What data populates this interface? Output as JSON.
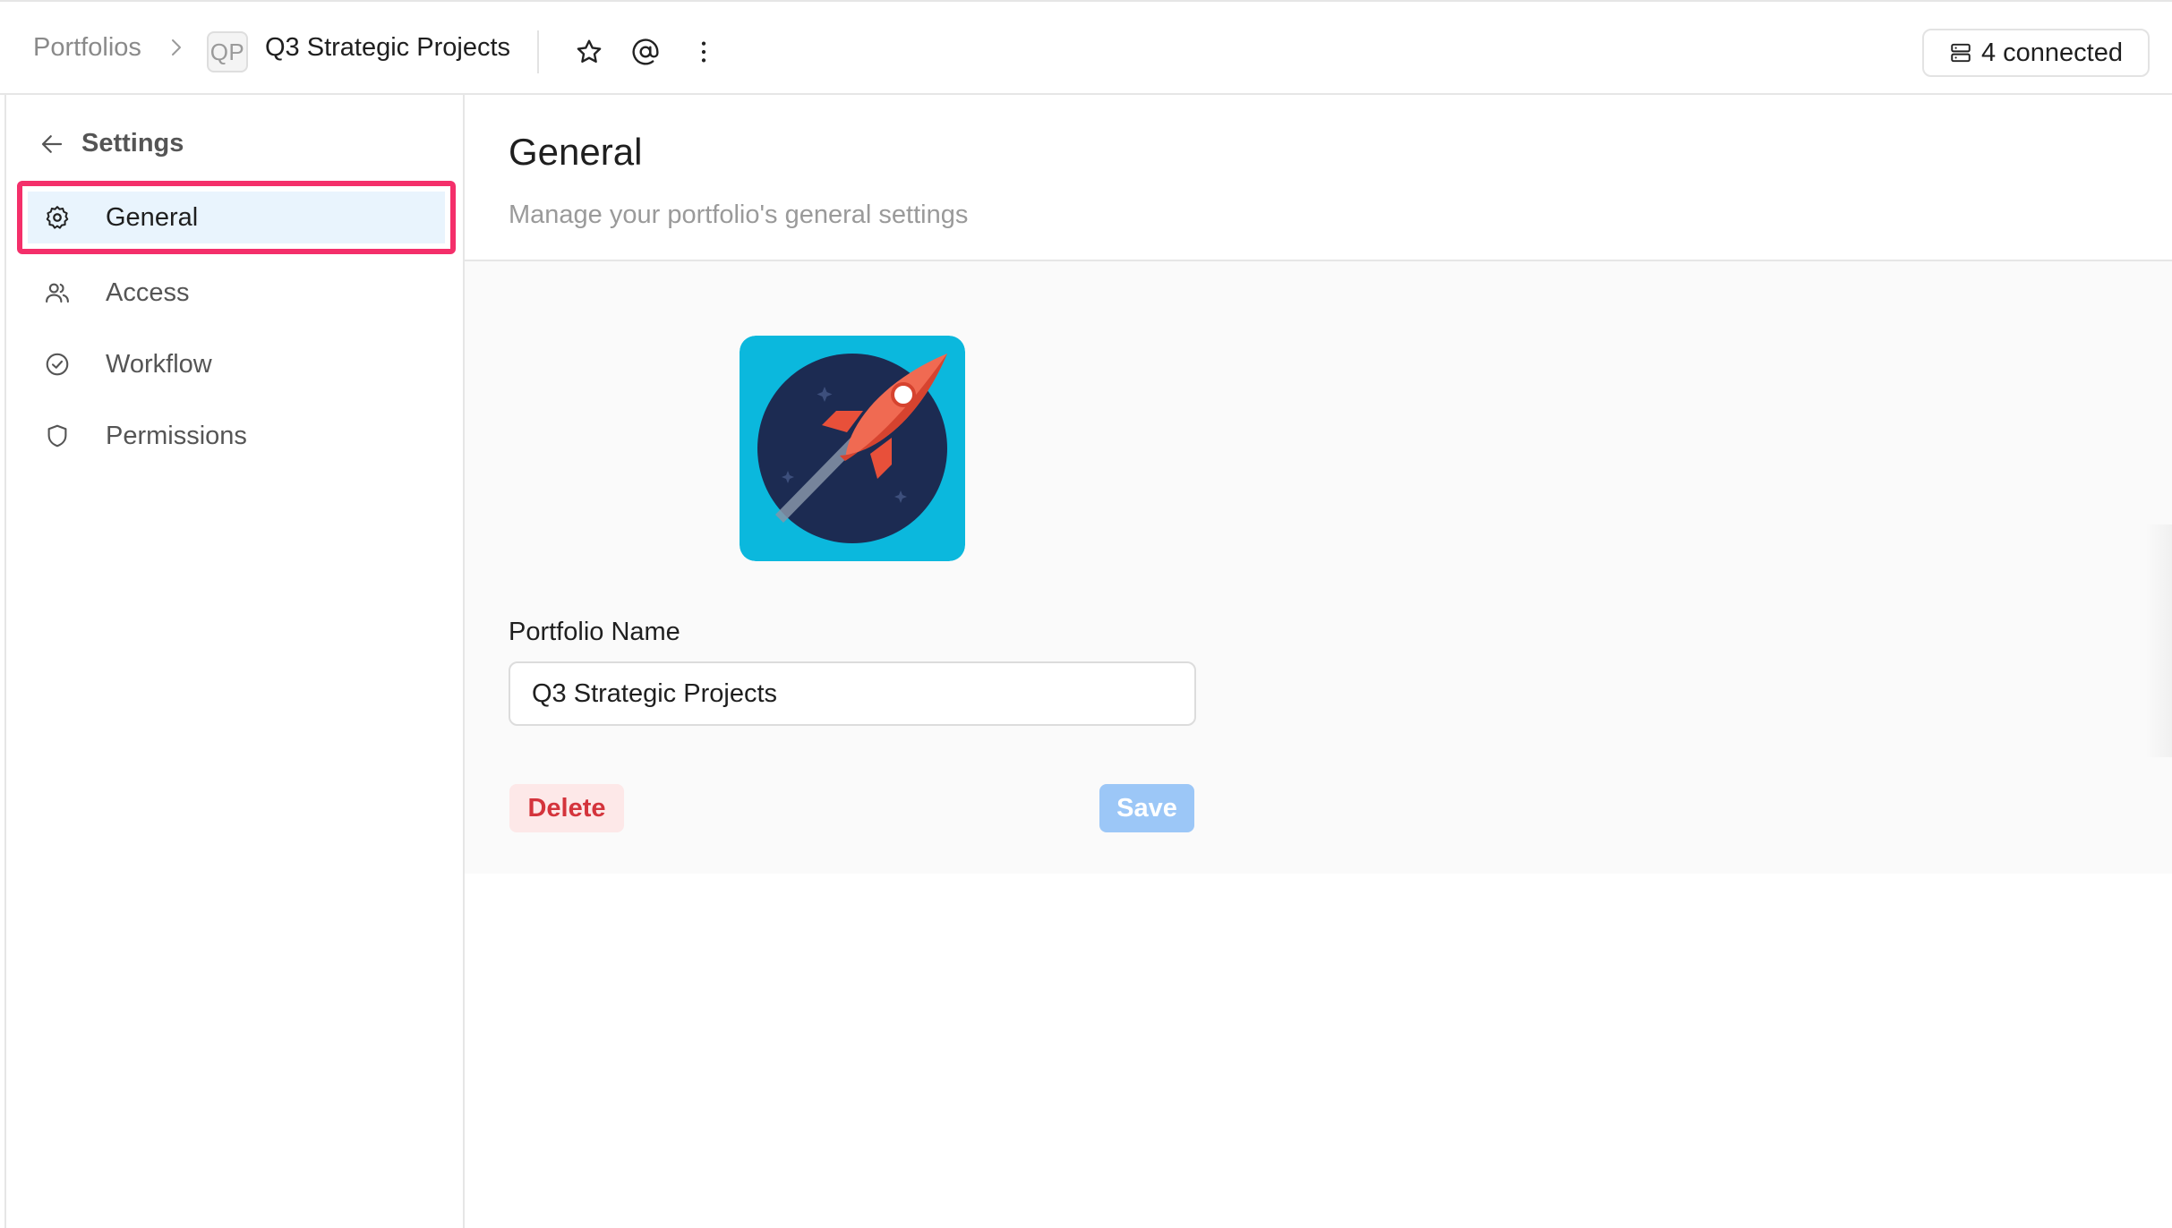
{
  "breadcrumb": {
    "root": "Portfolios",
    "avatar_initials": "QP",
    "current": "Q3 Strategic Projects"
  },
  "topbar": {
    "icons": [
      "star-icon",
      "at-sign-icon",
      "more-vertical-icon"
    ],
    "connected_label": "4 connected",
    "connected_icon": "database-icon"
  },
  "sidebar": {
    "back_label": "Settings",
    "items": [
      {
        "label": "General",
        "icon": "gear-icon",
        "active": true
      },
      {
        "label": "Access",
        "icon": "users-icon",
        "active": false
      },
      {
        "label": "Workflow",
        "icon": "check-circle-icon",
        "active": false
      },
      {
        "label": "Permissions",
        "icon": "shield-icon",
        "active": false
      }
    ]
  },
  "main": {
    "title": "General",
    "subtitle": "Manage your portfolio's general settings",
    "logo_icon": "rocket-logo",
    "name_label": "Portfolio Name",
    "name_value": "Q3 Strategic Projects",
    "delete_label": "Delete",
    "save_label": "Save"
  },
  "colors": {
    "active_highlight_border": "#f42f6a",
    "active_item_bg": "#e9f4fd",
    "delete_text": "#d4343c",
    "delete_bg": "#fde8e8",
    "save_bg": "#9cc7f7",
    "logo_bg": "#0bb8dd",
    "logo_circle": "#1c2b52",
    "rocket": "#e8503a"
  }
}
